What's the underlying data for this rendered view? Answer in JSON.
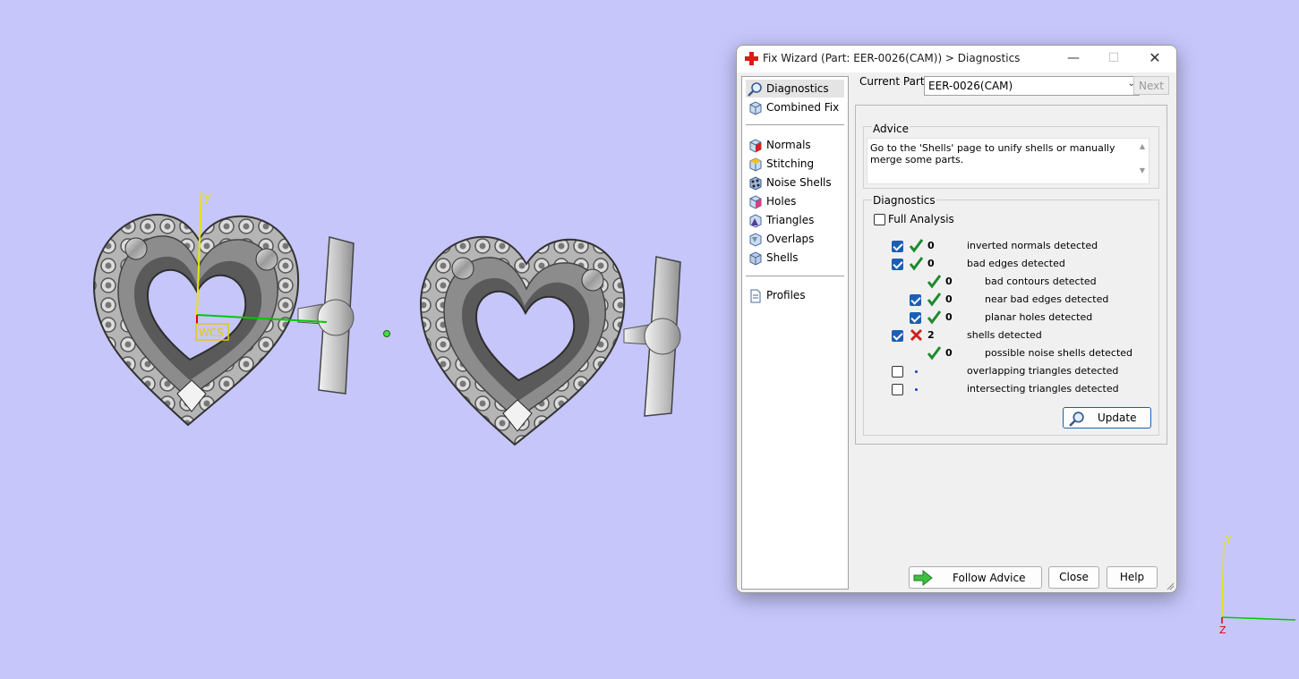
{
  "viewport": {
    "background": "#c6c6fb",
    "axis_label_y": "y",
    "wcs_label": "WCS",
    "mini_axis_y": "Y",
    "mini_axis_z": "Z"
  },
  "dialog": {
    "title": "Fix Wizard (Part: EER-0026(CAM)) > Diagnostics",
    "minimize_glyph": "—",
    "maximize_glyph": "☐",
    "close_glyph": "✕",
    "nav": {
      "top_items": [
        {
          "label": "Diagnostics",
          "icon": "magnifier-icon",
          "selected": true
        },
        {
          "label": "Combined Fix",
          "icon": "cube-icon"
        }
      ],
      "fix_items": [
        {
          "label": "Normals",
          "icon": "normals-cube-icon"
        },
        {
          "label": "Stitching",
          "icon": "stitching-cube-icon"
        },
        {
          "label": "Noise Shells",
          "icon": "noise-shells-icon"
        },
        {
          "label": "Holes",
          "icon": "holes-cube-icon"
        },
        {
          "label": "Triangles",
          "icon": "triangles-cube-icon"
        },
        {
          "label": "Overlaps",
          "icon": "overlaps-cube-icon"
        },
        {
          "label": "Shells",
          "icon": "shells-cube-icon"
        }
      ],
      "bottom_items": [
        {
          "label": "Profiles",
          "icon": "document-icon"
        }
      ]
    },
    "current_part_label": "Current Part:",
    "current_part_value": "EER-0026(CAM)",
    "next_label": "Next",
    "advice": {
      "title": "Advice",
      "text": "Go to the 'Shells' page to unify shells or manually merge some parts."
    },
    "diagnostics": {
      "title": "Diagnostics",
      "full_analysis_label": "Full Analysis",
      "full_analysis_checked": false,
      "rows": [
        {
          "checkbox": true,
          "status": "ok",
          "count": "0",
          "label": "inverted normals detected",
          "indent": 0
        },
        {
          "checkbox": true,
          "status": "ok",
          "count": "0",
          "label": "bad edges detected",
          "indent": 0
        },
        {
          "checkbox": null,
          "status": "ok",
          "count": "0",
          "label": "bad contours detected",
          "indent": 1
        },
        {
          "checkbox": true,
          "status": "ok",
          "count": "0",
          "label": "near bad edges detected",
          "indent": 1
        },
        {
          "checkbox": true,
          "status": "ok",
          "count": "0",
          "label": "planar holes detected",
          "indent": 1
        },
        {
          "checkbox": true,
          "status": "error",
          "count": "2",
          "label": "shells detected",
          "indent": 0
        },
        {
          "checkbox": null,
          "status": "ok",
          "count": "0",
          "label": "possible noise shells detected",
          "indent": 1
        },
        {
          "checkbox": false,
          "status": "none",
          "count": "",
          "label": "overlapping triangles detected",
          "indent": 0
        },
        {
          "checkbox": false,
          "status": "none",
          "count": "",
          "label": "intersecting triangles detected",
          "indent": 0
        }
      ],
      "update_label": "Update"
    },
    "buttons": {
      "follow_advice": "Follow Advice",
      "close": "Close",
      "help": "Help"
    }
  }
}
